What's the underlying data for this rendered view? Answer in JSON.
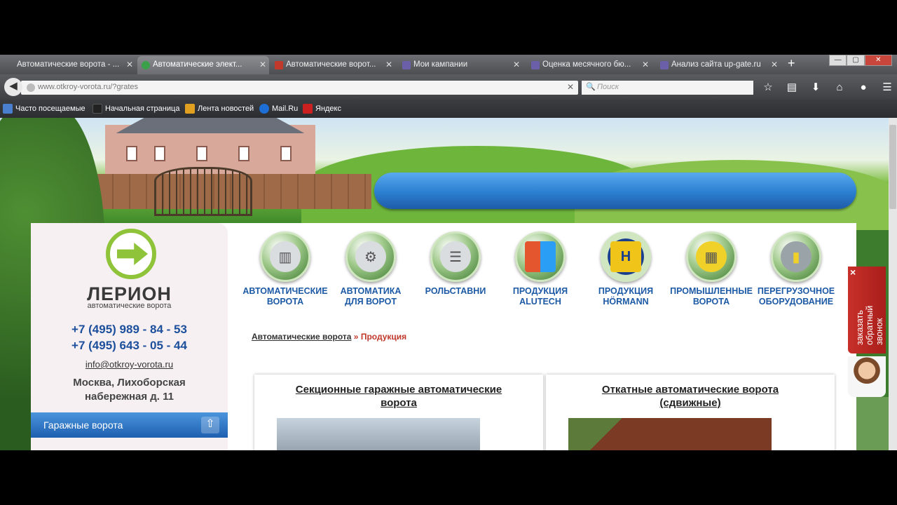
{
  "browser": {
    "tabs": [
      {
        "title": "Автоматические ворота - ...",
        "active": false,
        "favicon_color": "#7aa0c8"
      },
      {
        "title": "Автоматические элект...",
        "active": true,
        "favicon_color": "#3aa04a"
      },
      {
        "title": "Автоматические ворот...",
        "active": false,
        "favicon_color": "#c0392b"
      },
      {
        "title": "Мои кампании",
        "active": false,
        "favicon_color": "#6a5fa8"
      },
      {
        "title": "Оценка месячного бю...",
        "active": false,
        "favicon_color": "#6a5fa8"
      },
      {
        "title": "Анализ сайта up-gate.ru",
        "active": false,
        "favicon_color": "#6a5fa8"
      }
    ],
    "new_tab_symbol": "+",
    "url": "www.otkroy-vorota.ru/?grates",
    "search_placeholder": "Поиск",
    "bookmarks": [
      {
        "label": "Часто посещаемые",
        "icon_color": "#4a7fd0"
      },
      {
        "label": "Начальная страница",
        "icon_color": "#222"
      },
      {
        "label": "Лента новостей",
        "icon_color": "#e2a020"
      },
      {
        "label": "Mail.Ru",
        "icon_color": "#1d6fd6"
      },
      {
        "label": "Яндекс",
        "icon_color": "#cc2020"
      }
    ]
  },
  "site": {
    "logo_name": "ЛЕРИОН",
    "logo_tagline": "автоматические ворота",
    "phones": [
      "+7 (495) 989 - 84 - 53",
      "+7 (495) 643 - 05 - 44"
    ],
    "email": "info@otkroy-vorota.ru",
    "address_line1": "Москва, Лихоборская",
    "address_line2": "набережная д. 11",
    "sidebar_menu_item": "Гаражные ворота",
    "categories": [
      {
        "line1": "Автоматические",
        "line2": "ворота",
        "icon": "gate-icon"
      },
      {
        "line1": "Автоматика",
        "line2": "для ворот",
        "icon": "gears-icon"
      },
      {
        "line1": "Рольставни",
        "line2": "",
        "icon": "shutter-icon"
      },
      {
        "line1": "Продукция",
        "line2": "Alutech",
        "icon": "alutech-icon"
      },
      {
        "line1": "Продукция",
        "line2": "Hörmann",
        "icon": "hormann-icon"
      },
      {
        "line1": "Промышленные",
        "line2": "ворота",
        "icon": "industrial-gate-icon"
      },
      {
        "line1": "Перегрузочное",
        "line2": "оборудование",
        "icon": "loading-dock-icon"
      }
    ],
    "breadcrumb": {
      "home": "Автоматические ворота",
      "separator": "»",
      "current": "Продукция"
    },
    "products": [
      {
        "title_line1": "Секционные гаражные автоматические",
        "title_line2": "ворота"
      },
      {
        "title_line1": "Откатные автоматические ворота",
        "title_line2": "(сдвижные)"
      }
    ],
    "callback_widget": {
      "close_symbol": "×",
      "text_line1": "заказать",
      "text_line2": "обратный",
      "text_line3": "звонок"
    }
  },
  "colors": {
    "accent_blue": "#1d5aa5",
    "accent_green": "#8fc43a",
    "callback_red": "#c8302a"
  }
}
